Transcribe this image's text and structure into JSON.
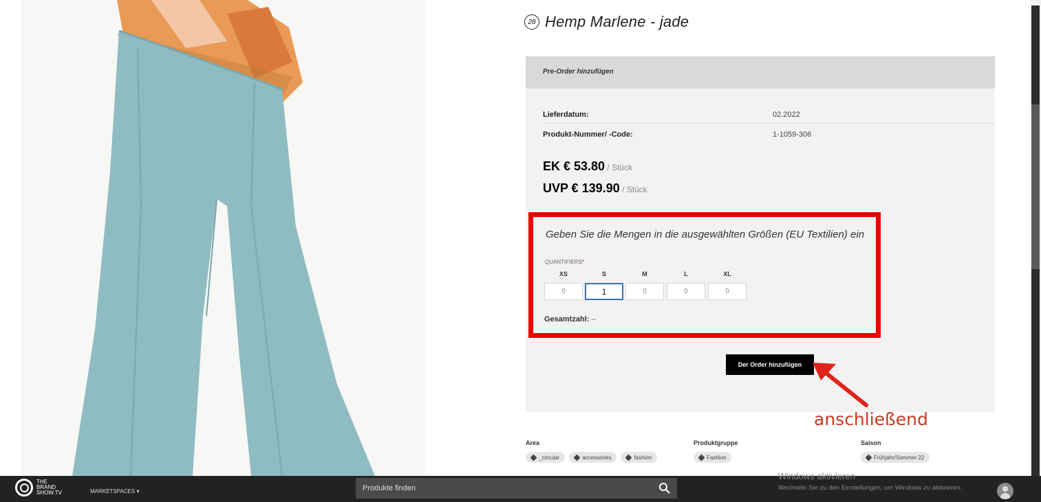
{
  "product": {
    "badge": "28",
    "title": "Hemp Marlene - jade"
  },
  "order": {
    "header": "Pre-Order hinzufügen",
    "delivery_label": "Lieferdatum:",
    "delivery_value": "02.2022",
    "code_label": "Produkt-Nummer/ -Code:",
    "code_value": "1-1059-306",
    "ek_price": "EK € 53.80",
    "ek_unit": " / Stück",
    "uvp_price": "UVP € 139.90",
    "uvp_unit": " / Stück",
    "sizes_heading": "Geben Sie die Mengen in die ausgewählten Größen (EU Textilien) ein",
    "quantifiers_label": "QUANTIFIERS",
    "required_mark": "*",
    "sizes": [
      {
        "label": "XS",
        "value": "0"
      },
      {
        "label": "S",
        "value": "1"
      },
      {
        "label": "M",
        "value": "0"
      },
      {
        "label": "L",
        "value": "0"
      },
      {
        "label": "XL",
        "value": "0"
      }
    ],
    "total_label": "Gesamtzahl:",
    "total_value": " –",
    "add_button": "Der Order hinzufügen"
  },
  "annotation": {
    "text": "anschließend",
    "color": "#e0231b"
  },
  "attributes": {
    "area": {
      "label": "Area",
      "tags": [
        "_circular",
        "accessories",
        "fashion"
      ]
    },
    "group": {
      "label": "Produktgruppe",
      "tags": [
        "Fashion"
      ]
    },
    "season": {
      "label": "Saison",
      "tags": [
        "Frühjahr/Sommer 22"
      ]
    }
  },
  "bottom_bar": {
    "logo_line1": "THE",
    "logo_line2": "BRAND",
    "logo_line3": "SHOW.TV",
    "marketspaces": "MARKETSPACES",
    "search_placeholder": "Produkte finden",
    "windows_line1": "Windows aktivieren",
    "windows_line2": "Wechseln Sie zu den Einstellungen, um Windows zu aktivieren."
  },
  "colors": {
    "highlight_border": "#e00000",
    "pants": "#8fbcc1",
    "bottom_bar": "#222222"
  }
}
